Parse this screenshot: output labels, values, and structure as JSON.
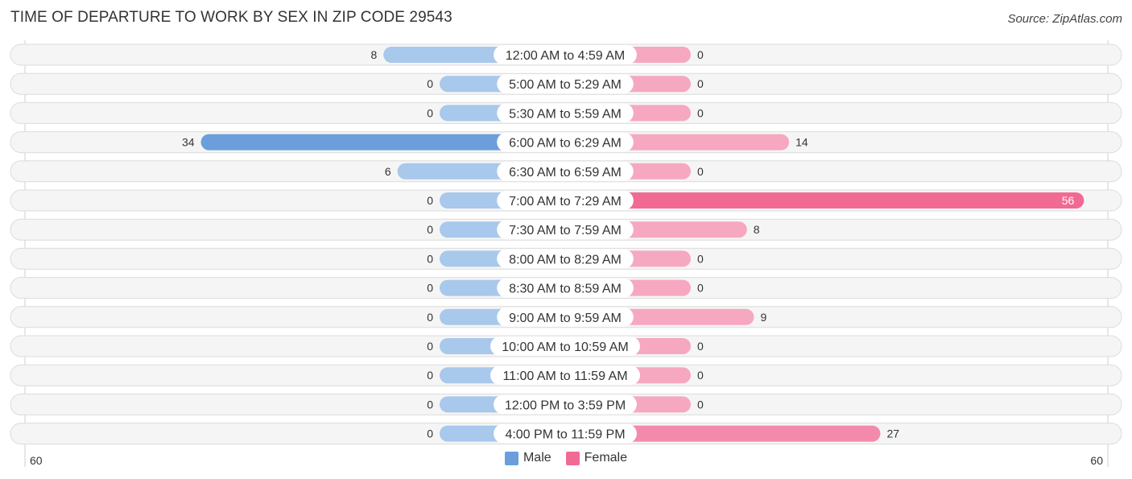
{
  "header": {
    "title": "TIME OF DEPARTURE TO WORK BY SEX IN ZIP CODE 29543",
    "source": "Source: ZipAtlas.com"
  },
  "colors": {
    "male": "#6a9fdc",
    "male_light": "#a8c8ec",
    "female": "#f06a94",
    "female_light": "#f6a8c0",
    "row_bg": "#f5f5f5"
  },
  "legend": {
    "male_label": "Male",
    "female_label": "Female"
  },
  "chart_data": {
    "type": "bar",
    "orientation": "horizontal-diverging",
    "title": "TIME OF DEPARTURE TO WORK BY SEX IN ZIP CODE 29543",
    "categories": [
      "12:00 AM to 4:59 AM",
      "5:00 AM to 5:29 AM",
      "5:30 AM to 5:59 AM",
      "6:00 AM to 6:29 AM",
      "6:30 AM to 6:59 AM",
      "7:00 AM to 7:29 AM",
      "7:30 AM to 7:59 AM",
      "8:00 AM to 8:29 AM",
      "8:30 AM to 8:59 AM",
      "9:00 AM to 9:59 AM",
      "10:00 AM to 10:59 AM",
      "11:00 AM to 11:59 AM",
      "12:00 PM to 3:59 PM",
      "4:00 PM to 11:59 PM"
    ],
    "series": [
      {
        "name": "Male",
        "values": [
          8,
          0,
          0,
          34,
          6,
          0,
          0,
          0,
          0,
          0,
          0,
          0,
          0,
          0
        ]
      },
      {
        "name": "Female",
        "values": [
          0,
          0,
          0,
          14,
          0,
          56,
          8,
          0,
          0,
          9,
          0,
          0,
          0,
          27
        ]
      }
    ],
    "axis": {
      "left_label": "60",
      "right_label": "60",
      "max": 60
    },
    "legend_position": "bottom-center",
    "grid": false
  }
}
